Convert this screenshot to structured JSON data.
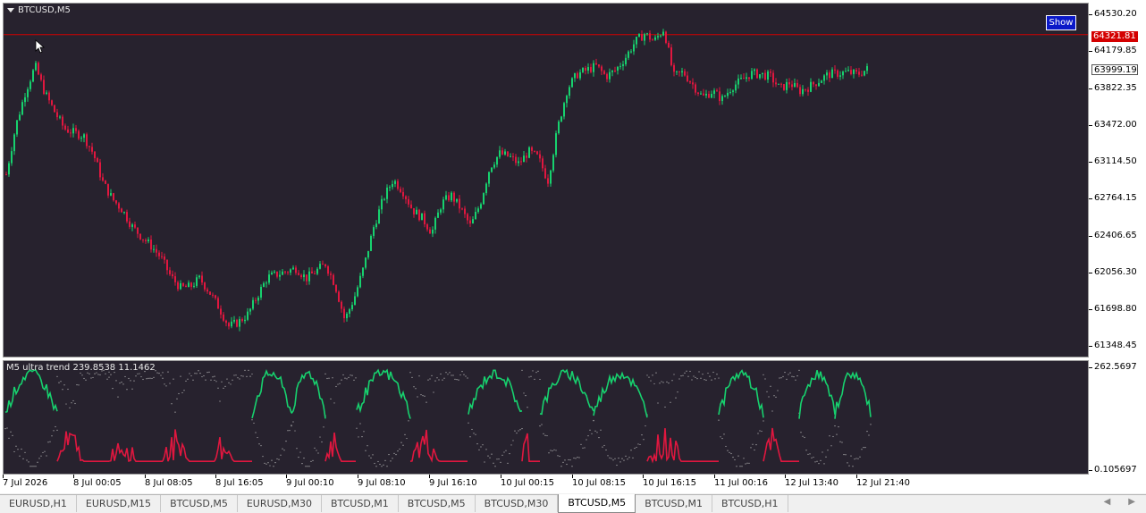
{
  "chart": {
    "symbol_label": "BTCUSD,M5",
    "show_button": "Show",
    "indicator_label": "M5 ultra trend  239.8538 11.1462",
    "price_ticks": [
      "64530.20",
      "64179.85",
      "63822.35",
      "63472.00",
      "63114.50",
      "62764.15",
      "62406.65",
      "62056.30",
      "61698.80",
      "61348.45"
    ],
    "price_range": [
      61230,
      64620
    ],
    "alert_line_price": "64321.81",
    "current_price": "63999.19",
    "indicator_max": "262.5697",
    "indicator_min": "0.105697",
    "time_ticks": [
      "7 Jul 2026",
      "8 Jul 00:05",
      "8 Jul 08:05",
      "8 Jul 16:05",
      "9 Jul 00:10",
      "9 Jul 08:10",
      "9 Jul 16:10",
      "10 Jul 00:15",
      "10 Jul 08:15",
      "10 Jul 16:15",
      "11 Jul 00:16",
      "12 Jul 13:40",
      "12 Jul 21:40"
    ],
    "colors": {
      "background": "#27222e",
      "bull": "#17d16e",
      "bear": "#e0173f",
      "alert_line": "#d40000",
      "dotted": "#b8b8b8",
      "show_button": "#0a18c8"
    }
  },
  "tabs": [
    {
      "label": "EURUSD,H1",
      "active": false
    },
    {
      "label": "EURUSD,M15",
      "active": false
    },
    {
      "label": "BTCUSD,M5",
      "active": false
    },
    {
      "label": "EURUSD,M30",
      "active": false
    },
    {
      "label": "BTCUSD,M1",
      "active": false
    },
    {
      "label": "BTCUSD,M5",
      "active": false
    },
    {
      "label": "BTCUSD,M30",
      "active": false
    },
    {
      "label": "BTCUSD,M5",
      "active": true
    },
    {
      "label": "BTCUSD,M1",
      "active": false
    },
    {
      "label": "BTCUSD,H1",
      "active": false
    }
  ],
  "price_path": [
    62980,
    63450,
    63780,
    64020,
    63760,
    63580,
    63420,
    63380,
    63350,
    63180,
    62900,
    62740,
    62640,
    62480,
    62380,
    62290,
    62180,
    62000,
    61890,
    61900,
    61980,
    61850,
    61700,
    61520,
    61560,
    61640,
    61820,
    61990,
    62020,
    62050,
    62080,
    61980,
    62050,
    62120,
    61920,
    61580,
    61800,
    62100,
    62480,
    62750,
    62930,
    62820,
    62640,
    62560,
    62420,
    62700,
    62780,
    62650,
    62480,
    62700,
    63050,
    63180,
    63150,
    63080,
    63200,
    63140,
    62920,
    63420,
    63800,
    63940,
    63980,
    64020,
    63920,
    63980,
    64100,
    64250,
    64330,
    64260,
    64380,
    63920,
    63960,
    63840,
    63720,
    63780,
    63700,
    63820,
    63880,
    63950,
    63940,
    63920,
    63800,
    63860,
    63780,
    63820,
    63880,
    63940,
    63950,
    63960,
    63940,
    63990
  ]
}
